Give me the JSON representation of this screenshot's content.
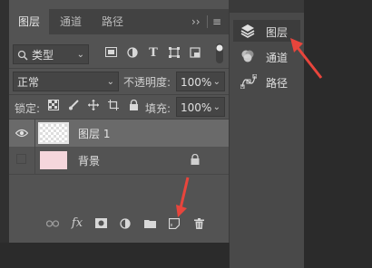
{
  "tabs": [
    {
      "label": "图层",
      "active": true
    },
    {
      "label": "通道",
      "active": false
    },
    {
      "label": "路径",
      "active": false
    }
  ],
  "tab_menu": {
    "collapse": "››",
    "menu": "≡"
  },
  "filter": {
    "kind_label": "类型",
    "icon_names": [
      "image-filter-icon",
      "adjustment-filter-icon",
      "type-filter-icon",
      "shape-filter-icon",
      "smart-object-filter-icon",
      "filter-toggle-icon"
    ],
    "type_glyph": "T"
  },
  "blend": {
    "mode": "正常",
    "opacity_label": "不透明度:",
    "opacity_value": "100%"
  },
  "lock": {
    "label": "锁定:",
    "fill_label": "填充:",
    "fill_value": "100%"
  },
  "layers": [
    {
      "name": "图层 1",
      "visible": true,
      "selected": true
    },
    {
      "name": "背景",
      "visible": false,
      "selected": false,
      "locked": true
    }
  ],
  "footer_icons": [
    "link-icon",
    "fx-icon",
    "mask-icon",
    "adjustment-icon",
    "folder-icon",
    "new-layer-icon",
    "trash-icon"
  ],
  "footer_fx": "fx",
  "side_panel": {
    "items": [
      {
        "label": "图层",
        "active": true
      },
      {
        "label": "通道",
        "active": false
      },
      {
        "label": "路径",
        "active": false
      }
    ]
  },
  "colors": {
    "panel": "#535353",
    "annotation_arrow": "#e8453c"
  }
}
